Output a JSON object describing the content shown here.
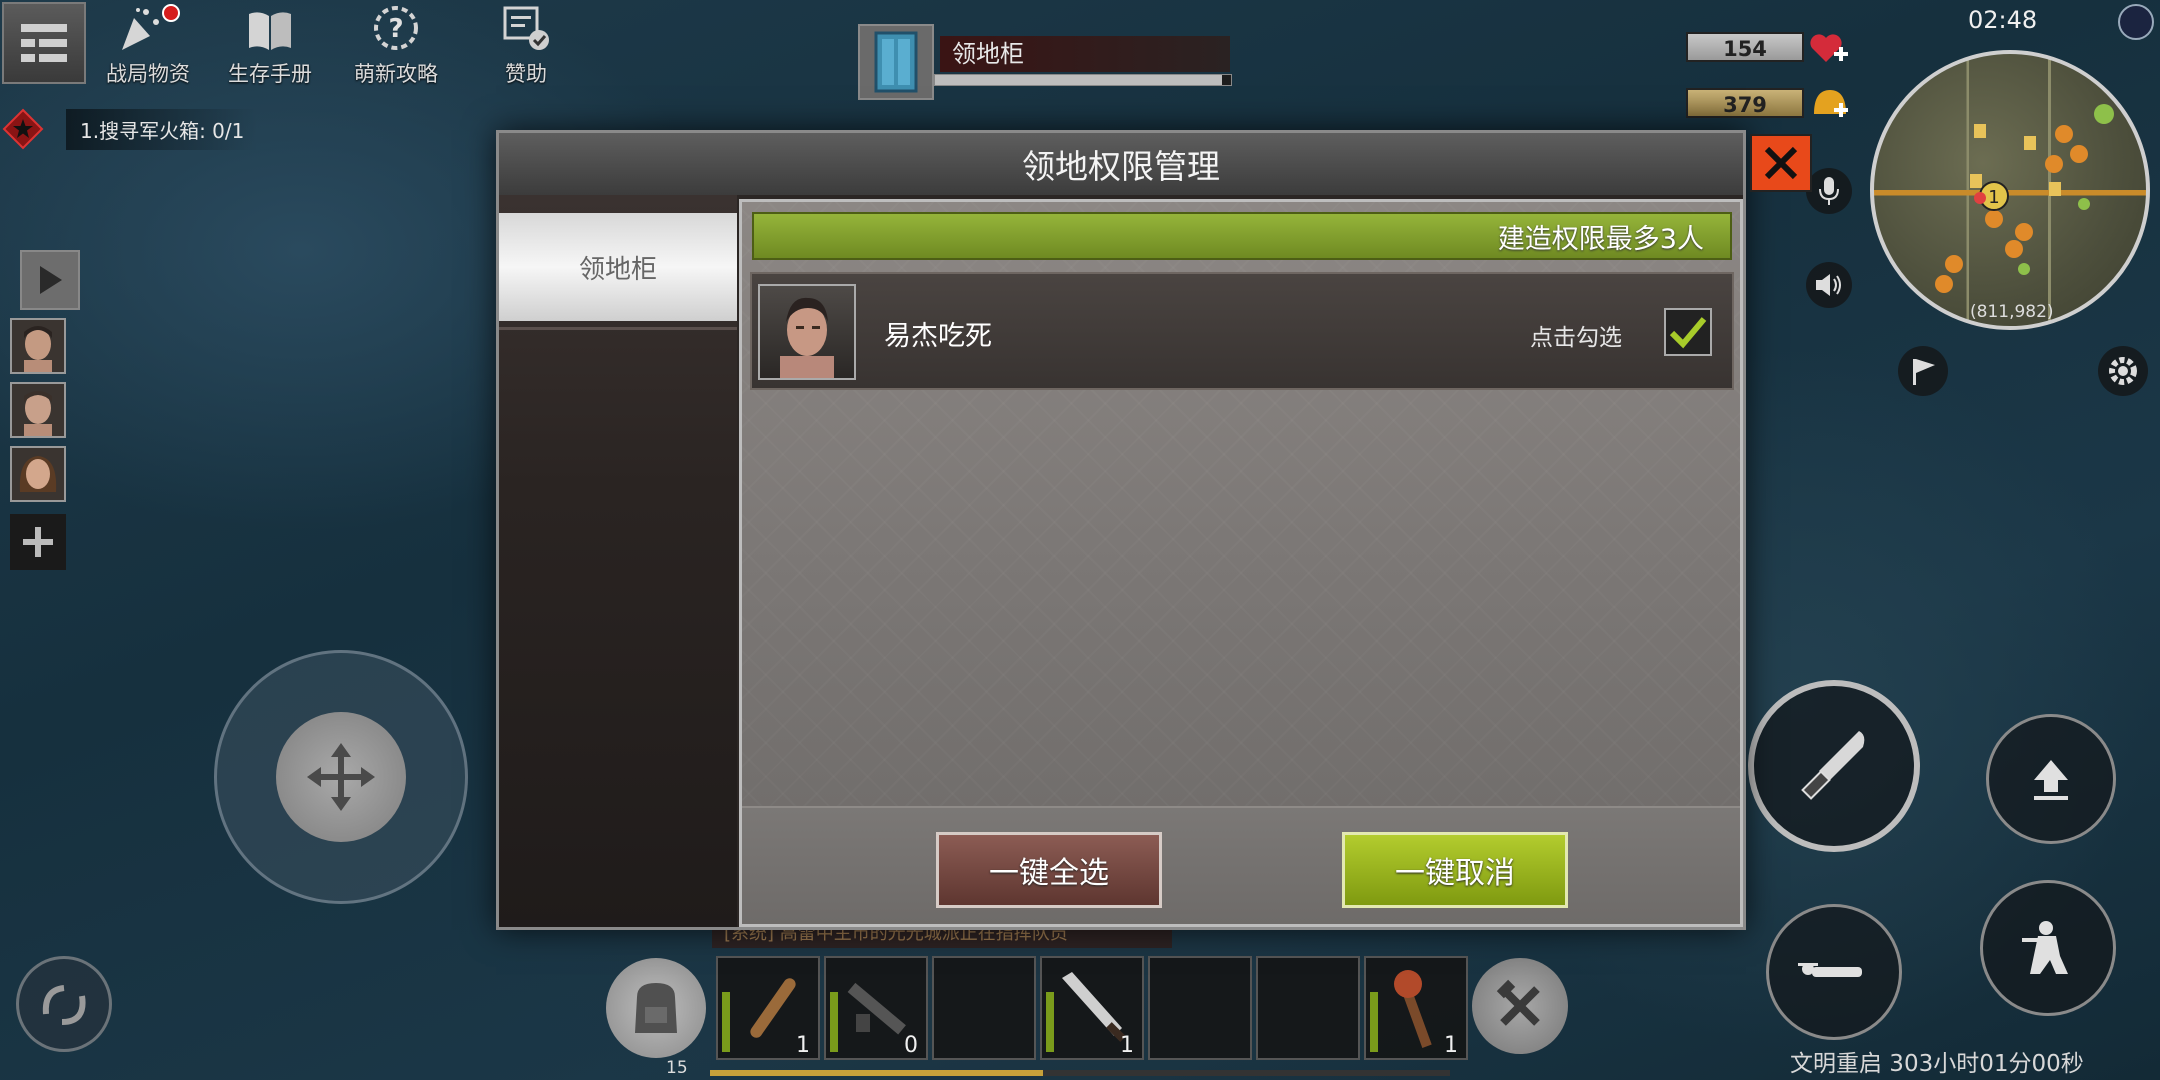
{
  "top_menu": {
    "items": [
      {
        "label": "战局物资",
        "icon": "confetti-icon"
      },
      {
        "label": "生存手册",
        "icon": "book-icon"
      },
      {
        "label": "萌新攻略",
        "icon": "help-icon"
      },
      {
        "label": "赞助",
        "icon": "sponsor-icon"
      }
    ]
  },
  "quest": {
    "text": "1.搜寻军火箱: 0/1"
  },
  "target": {
    "name": "领地柜",
    "health_fraction": 0.97
  },
  "stats": {
    "health": "154",
    "food": "379"
  },
  "clock": "02:48",
  "minimap": {
    "coordinates": "(811,982)",
    "marker_number": "1"
  },
  "modal": {
    "title": "领地权限管理",
    "sidebar_tab": "领地柜",
    "banner": "建造权限最多3人",
    "members": [
      {
        "name": "易杰吃死",
        "hint": "点击勾选",
        "checked": true
      }
    ],
    "select_all_label": "一键全选",
    "cancel_all_label": "一键取消"
  },
  "hotbar": {
    "level": "15",
    "slots": [
      {
        "count": "1",
        "durability": 0.8
      },
      {
        "count": "0",
        "durability": 0.5
      },
      {
        "count": "",
        "durability": 0
      },
      {
        "count": "1",
        "durability": 0.55
      },
      {
        "count": "",
        "durability": 0
      },
      {
        "count": "",
        "durability": 0
      },
      {
        "count": "1",
        "durability": 0.75
      }
    ],
    "xp_fraction": 0.45
  },
  "chat_snippet": "[系统] 高雷中主市的光光城派正在指挥队员",
  "restart_timer": "文明重启 303小时01分00秒",
  "colors": {
    "accent_green": "#95b43a",
    "close_orange": "#e8491a",
    "danger_red": "#d51d1d"
  }
}
